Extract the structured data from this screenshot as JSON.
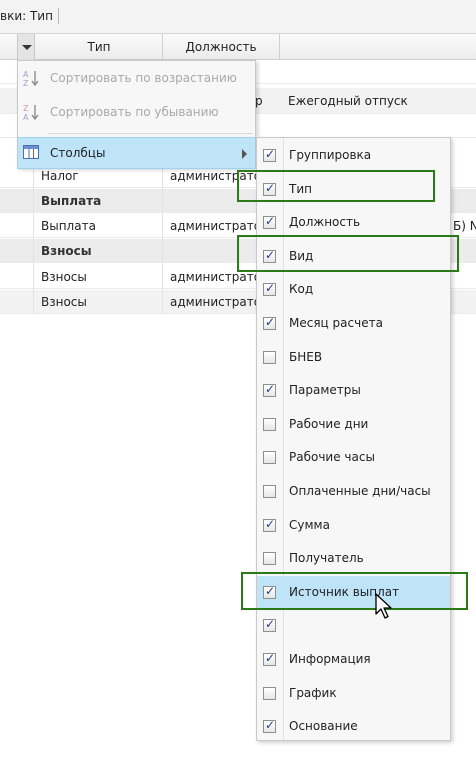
{
  "topbar": {
    "label": "вки: Тип"
  },
  "header": {
    "col_type": "Тип",
    "col_position": "Должность"
  },
  "partial": {
    "r": "р",
    "annual_leave": "Ежегодный отпуск",
    "suffix": "Б) N"
  },
  "rows": [
    {
      "c1": "Налог",
      "c2": "администрато"
    },
    {
      "c1": "Выплата"
    },
    {
      "c1": "Выплата",
      "c2": "администрато"
    },
    {
      "c1": "Взносы"
    },
    {
      "c1": "Взносы",
      "c2": "администрато"
    },
    {
      "c1": "Взносы",
      "c2": "администрато"
    }
  ],
  "menu": {
    "sort_asc": "Сортировать по возрастанию",
    "sort_desc": "Сортировать по убыванию",
    "columns": "Столбцы"
  },
  "columns_menu": [
    {
      "label": "Группировка",
      "checked": true
    },
    {
      "label": "Тип",
      "checked": true
    },
    {
      "label": "Должность",
      "checked": true
    },
    {
      "label": "Вид",
      "checked": true
    },
    {
      "label": "Код",
      "checked": true
    },
    {
      "label": "Месяц расчета",
      "checked": true
    },
    {
      "label": "БНЕВ",
      "checked": false
    },
    {
      "label": "Параметры",
      "checked": true
    },
    {
      "label": "Рабочие дни",
      "checked": false
    },
    {
      "label": "Рабочие часы",
      "checked": false
    },
    {
      "label": "Оплаченные дни/часы",
      "checked": false
    },
    {
      "label": "Сумма",
      "checked": true
    },
    {
      "label": "Получатель",
      "checked": false
    },
    {
      "label": "Источник выплат",
      "checked": true
    },
    {
      "label": "",
      "checked": true
    },
    {
      "label": "Информация",
      "checked": true
    },
    {
      "label": "График",
      "checked": false
    },
    {
      "label": "Основание",
      "checked": true
    }
  ],
  "colors": {
    "highlight": "#bfe4f8",
    "frame": "#2a7a17",
    "check": "#1e3f8a"
  },
  "icons": {
    "sort_asc": "sort-az-icon",
    "sort_desc": "sort-za-icon",
    "columns": "columns-icon",
    "submenu": "chevron-right-icon"
  }
}
